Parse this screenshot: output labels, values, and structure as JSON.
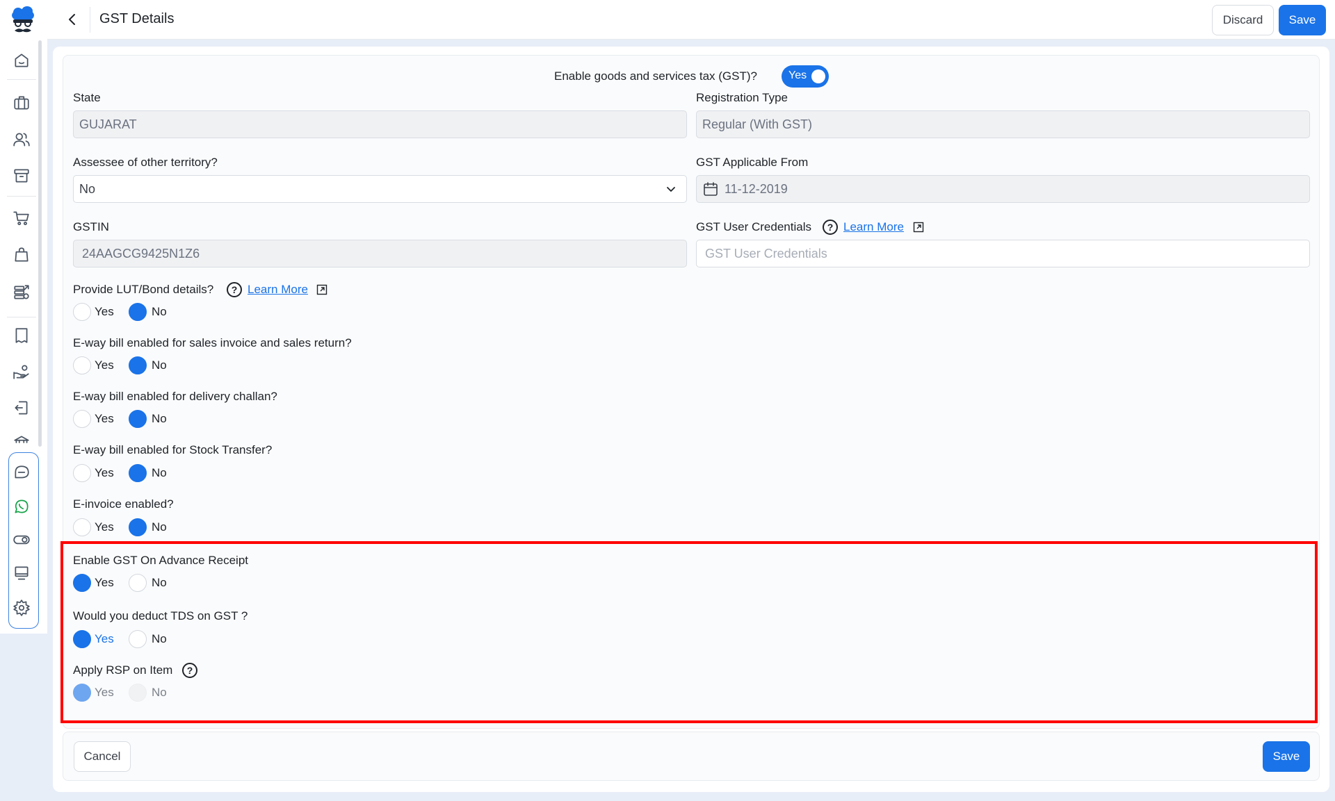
{
  "header": {
    "title": "GST Details",
    "discard_label": "Discard",
    "save_label": "Save"
  },
  "sidebar": {
    "items": [
      "home-icon",
      "briefcase-icon",
      "users-icon",
      "archive-icon",
      "cart-icon",
      "bag-icon",
      "database-icon",
      "receipt-icon",
      "hand-coins-icon",
      "exit-icon",
      "bank-icon"
    ],
    "group_items": [
      "chat-icon",
      "whatsapp-icon",
      "toggle-icon",
      "monitor-icon",
      "gear-icon"
    ]
  },
  "gst": {
    "enable_label": "Enable goods and services tax (GST)?",
    "toggle_label": "Yes"
  },
  "fields": {
    "state_label": "State",
    "state_value": "GUJARAT",
    "reg_type_label": "Registration Type",
    "reg_type_value": "Regular (With GST)",
    "assessee_label": "Assessee of other territory?",
    "assessee_value": "No",
    "applicable_from_label": "GST Applicable From",
    "applicable_from_value": "11-12-2019",
    "gstin_label": "GSTIN",
    "gstin_value": "24AAGCG9425N1Z6",
    "credentials_label": "GST User Credentials",
    "credentials_placeholder": "GST User Credentials",
    "learn_more": "Learn More"
  },
  "radios": {
    "yes": "Yes",
    "no": "No",
    "lut_label": "Provide LUT/Bond details?",
    "eway_sales_label": "E-way bill enabled for sales invoice and sales return?",
    "eway_challan_label": "E-way bill enabled for delivery challan?",
    "eway_stock_label": "E-way bill enabled for Stock Transfer?",
    "einvoice_label": "E-invoice enabled?",
    "advance_label": "Enable GST On Advance Receipt",
    "tds_label": "Would you deduct TDS on GST ?",
    "rsp_label": "Apply RSP on Item"
  },
  "footer": {
    "cancel_label": "Cancel",
    "save_label": "Save"
  },
  "colors": {
    "primary": "#1a73e8",
    "highlight": "#ff0000"
  }
}
